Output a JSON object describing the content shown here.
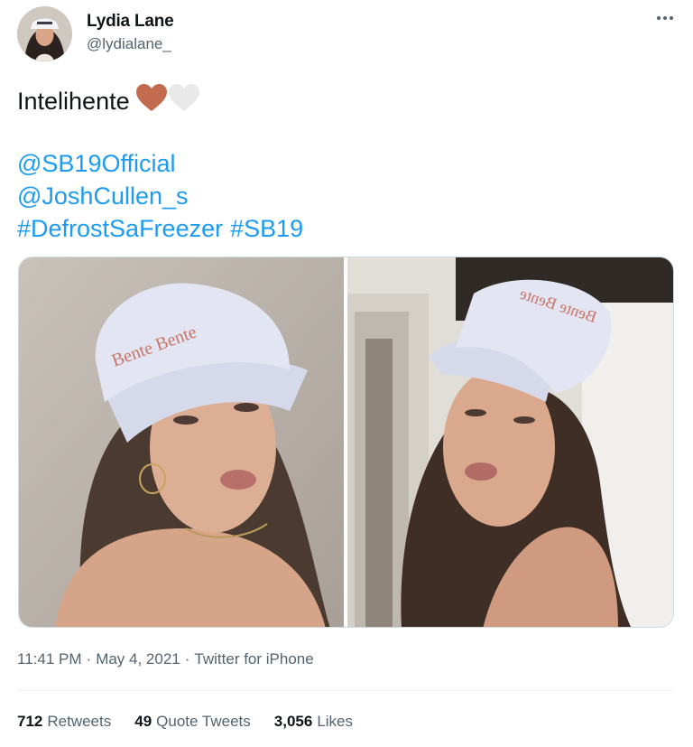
{
  "author": {
    "name": "Lydia Lane",
    "handle": "@lydialane_"
  },
  "tweet": {
    "text": "Intelihente",
    "emojis": [
      "brown-heart",
      "white-heart"
    ],
    "mentions": [
      "@SB19Official",
      "@JoshCullen_s"
    ],
    "hashtags": [
      "#DefrostSaFreezer",
      "#SB19"
    ]
  },
  "media": {
    "photo_left": {
      "cap_text": "Bente Bente"
    },
    "photo_right": {
      "cap_text": "Bente Bente"
    }
  },
  "meta": {
    "time": "11:41 PM",
    "date": "May 4, 2021",
    "source": "Twitter for iPhone",
    "separator": "·"
  },
  "stats": {
    "retweets_count": "712",
    "retweets_label": "Retweets",
    "quotes_count": "49",
    "quotes_label": "Quote Tweets",
    "likes_count": "3,056",
    "likes_label": "Likes"
  },
  "colors": {
    "link": "#1d9bf0",
    "secondary_text": "#536471",
    "brown_heart": "#c36b4f",
    "white_heart": "#e6e6e6"
  },
  "icons": {
    "more": "more-horizontal-icon",
    "brown_heart": "brown-heart-emoji",
    "white_heart": "white-heart-emoji"
  }
}
